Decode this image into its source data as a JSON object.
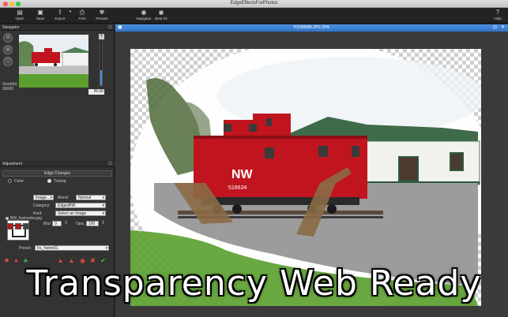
{
  "window": {
    "title": "EdgeEffectsForPhotos"
  },
  "toolbar": {
    "items": [
      {
        "label": "Open",
        "icon": "open-icon"
      },
      {
        "label": "Save",
        "icon": "save-icon"
      },
      {
        "label": "Export",
        "icon": "export-icon"
      },
      {
        "label": "Print",
        "icon": "print-icon"
      },
      {
        "label": "Presets",
        "icon": "presets-icon"
      },
      {
        "label": "Navigator",
        "icon": "navigator-icon"
      },
      {
        "label": "Best Fit",
        "icon": "best-fit-icon"
      },
      {
        "label": "Help",
        "icon": "help-icon"
      }
    ]
  },
  "navigator": {
    "title": "Navigator",
    "size_label": "Size(kb):",
    "size_value": "36000",
    "zoom_value": "25.00"
  },
  "adjustment": {
    "title": "Adjustment",
    "section": "Edge Changes",
    "color_label": "Color:",
    "transp_label": "Transp.",
    "mode_selected": "transp",
    "image_select": "Image...",
    "blend_label": "Blend:",
    "blend_value": "Normal",
    "category_label": "Category:",
    "category_value": "EdgesBW",
    "kind_label": "Kind:",
    "kind_value": "Select an Image",
    "file_name": "BW_frameoha.jpg",
    "blur_label": "Blur:",
    "blur_value": "0",
    "opa_label": "Opa.:",
    "opa_value": "100",
    "preset_label": "Preset:",
    "preset_value": "Irs_frame01"
  },
  "document": {
    "title": "P1030586.JPG 25%"
  },
  "photo": {
    "caboose_text": "NW",
    "caboose_number": "518634"
  },
  "overlay": {
    "text": "Transparency Web Ready"
  },
  "colors": {
    "accent": "#4a90e2",
    "caboose_red": "#c0151f",
    "grass": "#5aa02e",
    "background": "#2b2b2b"
  }
}
